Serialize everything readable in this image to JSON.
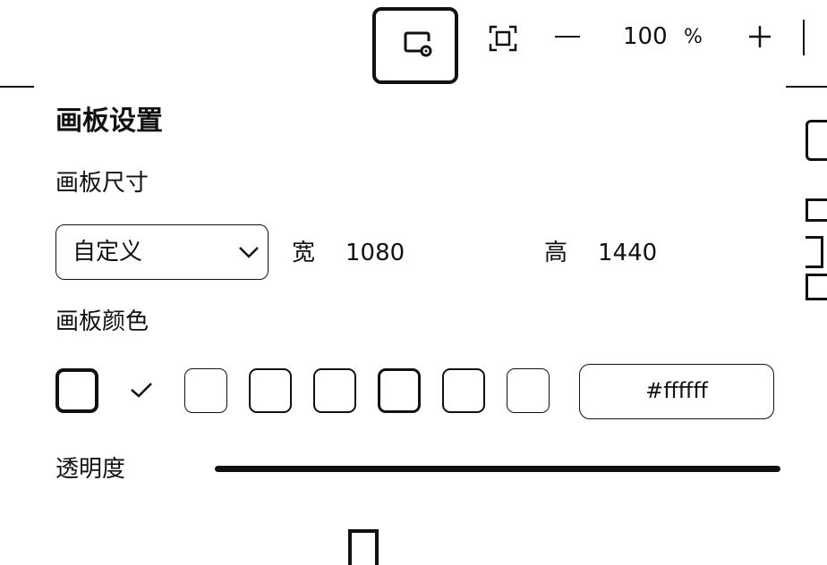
{
  "toolbar": {
    "settings_icon": "canvas-settings-icon",
    "fit_icon": "fit-screen-icon",
    "zoom_out_icon": "minus-icon",
    "zoom_value": "100",
    "zoom_unit": "%",
    "zoom_in_icon": "plus-icon"
  },
  "panel": {
    "title": "画板设置",
    "size_section": {
      "label": "画板尺寸",
      "preset_value": "自定义",
      "width_label": "宽",
      "width_value": "1080",
      "height_label": "高",
      "height_value": "1440"
    },
    "color_section": {
      "label": "画板颜色",
      "swatch_count": 8,
      "selected_index": 0,
      "hex_value": "#ffffff"
    },
    "opacity_section": {
      "label": "透明度",
      "value_fraction": 1.0
    }
  },
  "colors": {
    "foreground": "#111111",
    "background": "#ffffff"
  }
}
